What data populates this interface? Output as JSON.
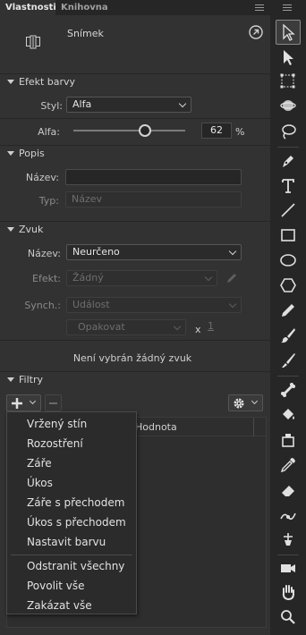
{
  "tabs": {
    "properties": "Vlastnosti",
    "library": "Knihovna"
  },
  "frame": {
    "label": "Snímek"
  },
  "color_effect": {
    "section_title": "Efekt barvy",
    "style_label": "Styl:",
    "style_value": "Alfa",
    "alpha_label": "Alfa:",
    "alpha_value": "62",
    "alpha_unit": "%",
    "alpha_fraction": 0.62
  },
  "description": {
    "section_title": "Popis",
    "name_label": "Název:",
    "name_value": "",
    "type_label": "Typ:",
    "type_placeholder": "Název"
  },
  "sound": {
    "section_title": "Zvuk",
    "name_label": "Název:",
    "name_value": "Neurčeno",
    "effect_label": "Efekt:",
    "effect_value": "Žádný",
    "sync_label": "Synch.:",
    "sync_value": "Událost",
    "repeat_value": "Opakovat",
    "repeat_times_label": "x",
    "repeat_count": "1",
    "status": "Není vybrán žádný zvuk"
  },
  "filters": {
    "section_title": "Filtry",
    "value_column": "Hodnota",
    "menu_items": [
      "Vržený stín",
      "Rozostření",
      "Záře",
      "Úkos",
      "Záře s přechodem",
      "Úkos s přechodem",
      "Nastavit barvu"
    ],
    "menu_actions": [
      "Odstranit všechny",
      "Povolit vše",
      "Zakázat vše"
    ]
  },
  "tools": [
    "selection-tool-icon",
    "subselection-tool-icon",
    "free-transform-tool-icon",
    "3d-rotation-tool-icon",
    "lasso-tool-icon",
    "pen-tool-icon",
    "text-tool-icon",
    "line-tool-icon",
    "rectangle-tool-icon",
    "oval-tool-icon",
    "polystar-tool-icon",
    "pencil-tool-icon",
    "paint-brush-tool-icon",
    "brush-tool-icon",
    "bone-tool-icon",
    "paint-bucket-tool-icon",
    "ink-bottle-tool-icon",
    "eyedropper-tool-icon",
    "eraser-tool-icon",
    "width-tool-icon",
    "asset-warp-tool-icon",
    "camera-tool-icon",
    "hand-tool-icon",
    "zoom-tool-icon"
  ],
  "colors": {
    "panel_bg": "#323232",
    "tool_bg": "#262626",
    "accent_text": "#e6e6e6"
  }
}
